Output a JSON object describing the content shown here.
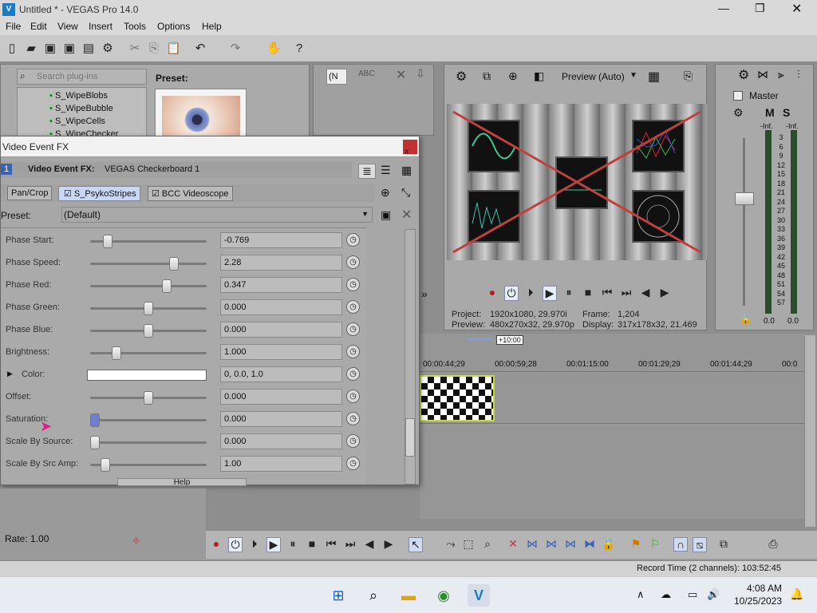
{
  "window": {
    "title": "Untitled * - VEGAS Pro 14.0"
  },
  "menu": [
    "File",
    "Edit",
    "View",
    "Insert",
    "Tools",
    "Options",
    "Help"
  ],
  "plugins": {
    "search_placeholder": "Search plug-ins",
    "preset_label": "Preset:",
    "items": [
      "S_WipeBlobs",
      "S_WipeBubble",
      "S_WipeCells",
      "S_WipeChecker"
    ]
  },
  "filter_select": "(N",
  "preview": {
    "mode": "Preview (Auto)",
    "project_label": "Project:",
    "project_value": "1920x1080, 29.970i",
    "frame_label": "Frame:",
    "frame_value": "1,204",
    "preview_label": "Preview:",
    "preview_value": "480x270x32, 29.970p",
    "display_label": "Display:",
    "display_value": "317x178x32, 21.469"
  },
  "master": {
    "title": "Master",
    "m_label": "M",
    "s_label": "S",
    "inf_left": "-Inf.",
    "inf_right": "-Inf.",
    "scale": [
      "3",
      "6",
      "9",
      "12",
      "15",
      "18",
      "21",
      "24",
      "27",
      "30",
      "33",
      "36",
      "39",
      "42",
      "45",
      "48",
      "51",
      "54",
      "57"
    ],
    "bottom_left": "0.0",
    "bottom_right": "0.0"
  },
  "fx": {
    "title": "Video Event FX",
    "close_label": "x",
    "track_no": "1",
    "chain_label": "Video Event FX:",
    "chain_value": "VEGAS Checkerboard 1",
    "tabs": [
      "Pan/Crop",
      "S_PsykoStripes",
      "BCC Videoscope"
    ],
    "preset_label": "Preset:",
    "preset_value": "(Default)",
    "help_label": "Help",
    "params": [
      {
        "label": "Phase Start:",
        "value": "-0.769",
        "pos": 0.12
      },
      {
        "label": "Phase Speed:",
        "value": "2.28",
        "pos": 0.74
      },
      {
        "label": "Phase Red:",
        "value": "0.347",
        "pos": 0.67
      },
      {
        "label": "Phase Green:",
        "value": "0.000",
        "pos": 0.5
      },
      {
        "label": "Phase Blue:",
        "value": "0.000",
        "pos": 0.5
      },
      {
        "label": "Brightness:",
        "value": "1.000",
        "pos": 0.2
      },
      {
        "label": "Color:",
        "value": "0, 0.0, 1.0",
        "pos": -1
      },
      {
        "label": "Offset:",
        "value": "0.000",
        "pos": 0.5
      },
      {
        "label": "Saturation:",
        "value": "0.000",
        "pos": 0.0
      },
      {
        "label": "Scale By Source:",
        "value": "0.000",
        "pos": 0.0
      },
      {
        "label": "Scale By Src Amp:",
        "value": "1.00",
        "pos": 0.1
      }
    ]
  },
  "timeline": {
    "marker": "+10:00",
    "times": [
      "00:00:44;29",
      "00:00:59;28",
      "00:01:15:00",
      "00:01:29;29",
      "00:01:44;29",
      "00:0"
    ]
  },
  "rate": "Rate: 1.00",
  "status": "Record Time (2 channels): 103:52:45",
  "taskbar": {
    "time": "4:08 AM",
    "date": "10/25/2023"
  }
}
